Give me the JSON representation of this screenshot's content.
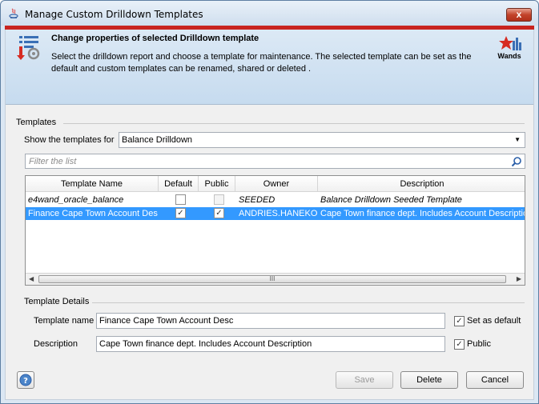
{
  "window": {
    "title": "Manage Custom Drilldown Templates",
    "close_label": "x"
  },
  "header": {
    "title": "Change properties of selected Drilldown template",
    "description": "Select the drilldown report and choose a template for maintenance. The selected template can be set as the default and custom templates can be renamed, shared or deleted .",
    "brand_label": "Wands"
  },
  "templates_group": {
    "label": "Templates",
    "show_label": "Show the templates for",
    "show_value": "Balance Drilldown",
    "filter_placeholder": "Filter the list"
  },
  "table": {
    "columns": [
      "Template Name",
      "Default",
      "Public",
      "Owner",
      "Description"
    ],
    "rows": [
      {
        "name": "e4wand_oracle_balance",
        "default": false,
        "public": false,
        "owner": "SEEDED",
        "description": "Balance Drilldown Seeded Template",
        "selected": false
      },
      {
        "name": "Finance Cape Town Account Desc",
        "default": true,
        "public": true,
        "owner": "ANDRIES.HANEKOM",
        "description": "Cape Town finance dept. Includes Account Description",
        "selected": true
      }
    ],
    "scroll_grip": "III"
  },
  "details_group": {
    "label": "Template Details",
    "name_label": "Template name",
    "name_value": "Finance Cape Town Account Desc",
    "description_label": "Description",
    "description_value": "Cape Town finance dept. Includes Account Description",
    "set_default_label": "Set as default",
    "set_default_checked": true,
    "public_label": "Public",
    "public_checked": true
  },
  "buttons": {
    "save": "Save",
    "delete": "Delete",
    "cancel": "Cancel",
    "help_icon": "question-circle-icon"
  },
  "colors": {
    "accent_red": "#c8241f",
    "selection_blue": "#3399ff"
  }
}
